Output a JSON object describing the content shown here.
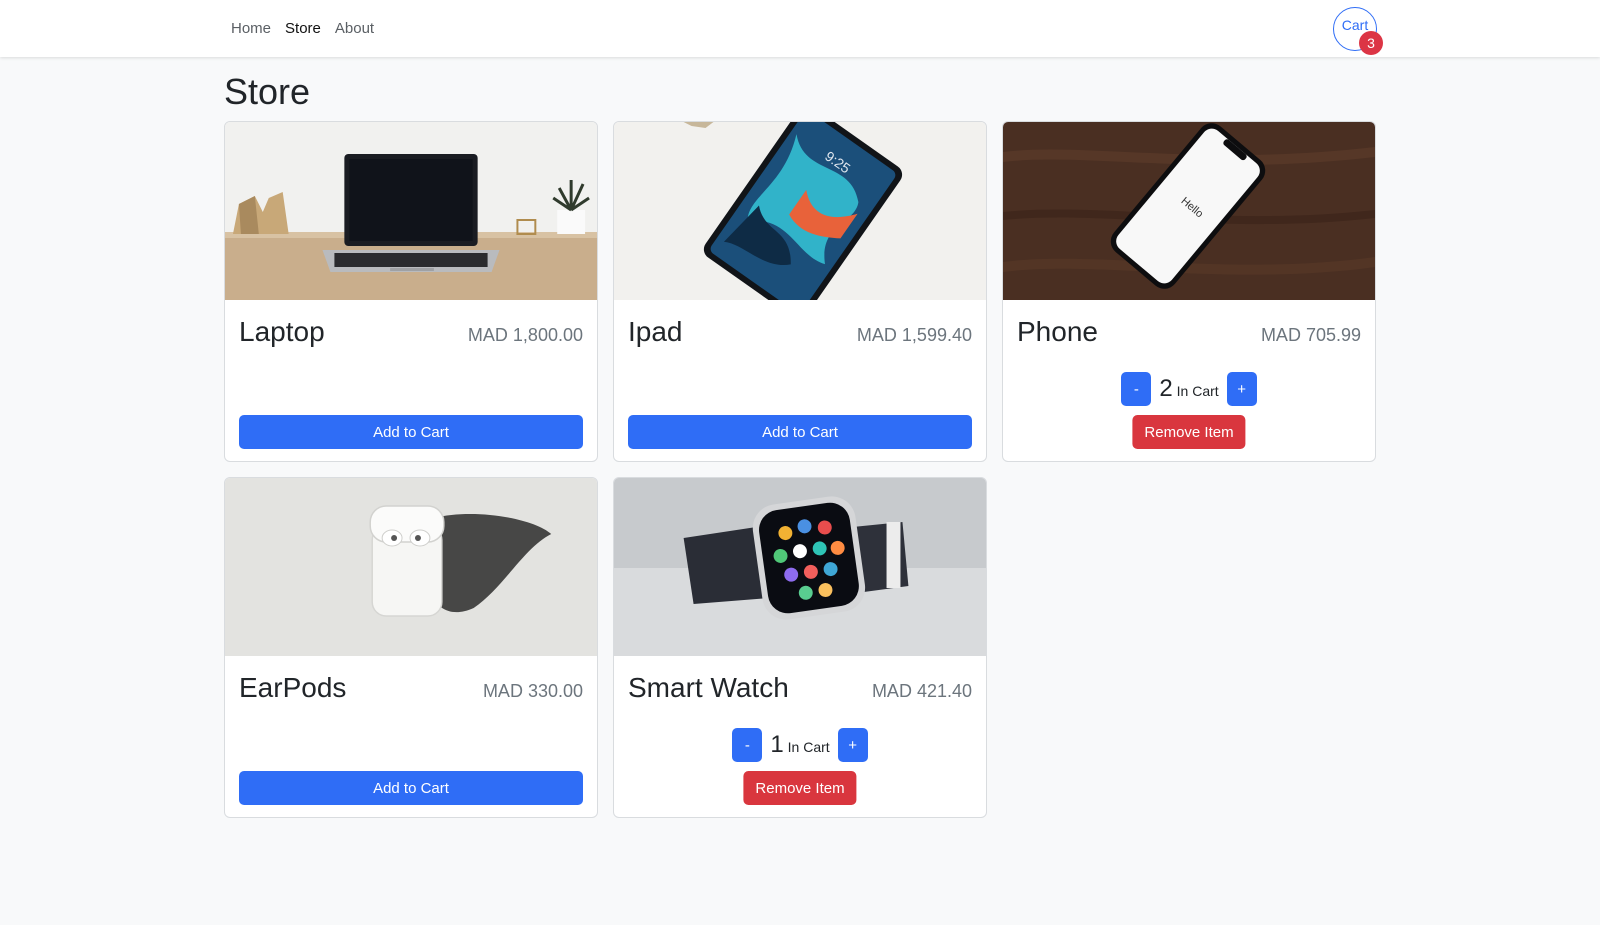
{
  "nav": {
    "links": [
      {
        "label": "Home",
        "active": false
      },
      {
        "label": "Store",
        "active": true
      },
      {
        "label": "About",
        "active": false
      }
    ],
    "cart_label": "Cart",
    "cart_count": "3"
  },
  "page_title": "Store",
  "colors": {
    "primary": "#2f6df6",
    "danger": "#d9363e",
    "price": "#6c757d"
  },
  "products": [
    {
      "name": "Laptop",
      "price": "MAD 1,800.00",
      "image": "laptop-photo",
      "in_cart": false,
      "add_label": "Add to Cart"
    },
    {
      "name": "Ipad",
      "price": "MAD 1,599.40",
      "image": "ipad-photo",
      "in_cart": false,
      "add_label": "Add to Cart"
    },
    {
      "name": "Phone",
      "price": "MAD 705.99",
      "image": "phone-photo",
      "in_cart": true,
      "quantity": "2",
      "in_cart_label": "In Cart",
      "minus": "-",
      "plus": "+",
      "remove_label": "Remove Item"
    },
    {
      "name": "EarPods",
      "price": "MAD 330.00",
      "image": "earpods-photo",
      "in_cart": false,
      "add_label": "Add to Cart"
    },
    {
      "name": "Smart Watch",
      "price": "MAD 421.40",
      "image": "smartwatch-photo",
      "in_cart": true,
      "quantity": "1",
      "in_cart_label": "In Cart",
      "minus": "-",
      "plus": "+",
      "remove_label": "Remove Item"
    }
  ]
}
